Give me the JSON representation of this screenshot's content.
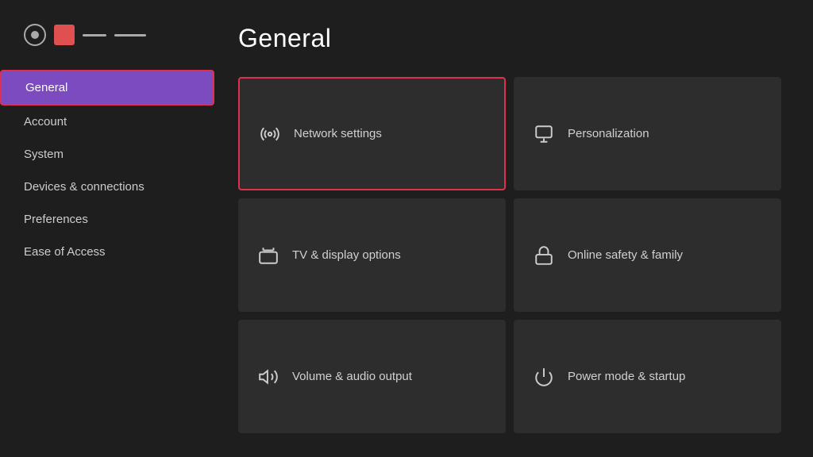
{
  "sidebar": {
    "nav_items": [
      {
        "label": "General",
        "active": true
      },
      {
        "label": "Account",
        "active": false
      },
      {
        "label": "System",
        "active": false
      },
      {
        "label": "Devices & connections",
        "active": false
      },
      {
        "label": "Preferences",
        "active": false
      },
      {
        "label": "Ease of Access",
        "active": false
      }
    ]
  },
  "main": {
    "title": "General",
    "tiles": [
      {
        "id": "network-settings",
        "label": "Network settings",
        "focused": true
      },
      {
        "id": "personalization",
        "label": "Personalization",
        "focused": false
      },
      {
        "id": "tv-display",
        "label": "TV & display options",
        "focused": false
      },
      {
        "id": "online-safety",
        "label": "Online safety & family",
        "focused": false
      },
      {
        "id": "volume-audio",
        "label": "Volume & audio output",
        "focused": false
      },
      {
        "id": "power-mode",
        "label": "Power mode & startup",
        "focused": false
      }
    ]
  }
}
